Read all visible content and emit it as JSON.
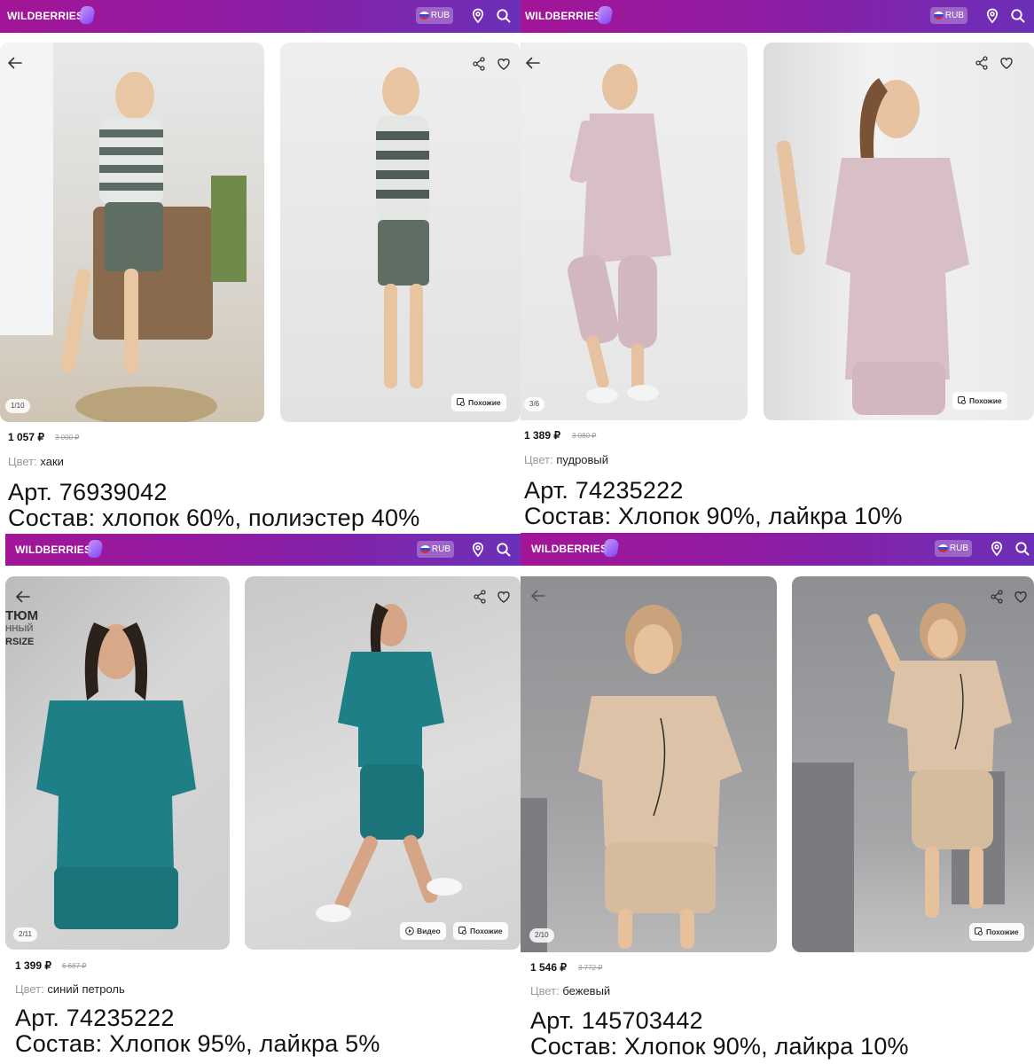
{
  "app": {
    "logo_text": "WILDBERRIES",
    "currency_label": "RUB",
    "brand_gradient": [
      "#a31597",
      "#6c2fb8"
    ]
  },
  "icons": {
    "location": "location-pin-icon",
    "search": "search-icon",
    "back": "arrow-left-icon",
    "share": "share-icon",
    "favorite": "heart-icon",
    "similar": "similar-search-icon",
    "video": "play-icon"
  },
  "products": [
    {
      "photo_counter": "1/10",
      "similar_label": "Похожие",
      "price": "1 057 ₽",
      "old_price": "3 000 ₽",
      "color_label": "Цвет:",
      "color_value": "хаки",
      "article": "Арт. 76939042",
      "composition": "Состав: хлопок 60%, полиэстер 40%",
      "top_color": "#dfe3df",
      "bottom_color": "#5f6e62"
    },
    {
      "photo_counter": "3/6",
      "similar_label": "Похожие",
      "price": "1 389 ₽",
      "old_price": "3 080 ₽",
      "color_label": "Цвет:",
      "color_value": "пудровый",
      "article": "Арт. 74235222",
      "composition": "Состав: Хлопок 90%, лайкра 10%",
      "top_color": "#d8bfc6",
      "bottom_color": "#d3b7bf"
    },
    {
      "photo_counter": "2/11",
      "promo_lines": [
        "ТЮМ",
        "ННЫЙ",
        "RSIZE"
      ],
      "video_label": "Видео",
      "similar_label": "Похожие",
      "price": "1 399 ₽",
      "old_price": "6 687 ₽",
      "color_label": "Цвет:",
      "color_value": "синий петроль",
      "article": "Арт. 74235222",
      "composition": "Состав: Хлопок 95%, лайкра 5%",
      "top_color": "#1f7f86",
      "bottom_color": "#1c747b"
    },
    {
      "photo_counter": "2/10",
      "similar_label": "Похожие",
      "price": "1 546 ₽",
      "old_price": "3 772 ₽",
      "color_label": "Цвет:",
      "color_value": "бежевый",
      "article": "Арт. 145703442",
      "composition": "Состав: Хлопок 90%, лайкра 10%",
      "top_color": "#dcc3a8",
      "bottom_color": "#d6bc9f"
    }
  ]
}
